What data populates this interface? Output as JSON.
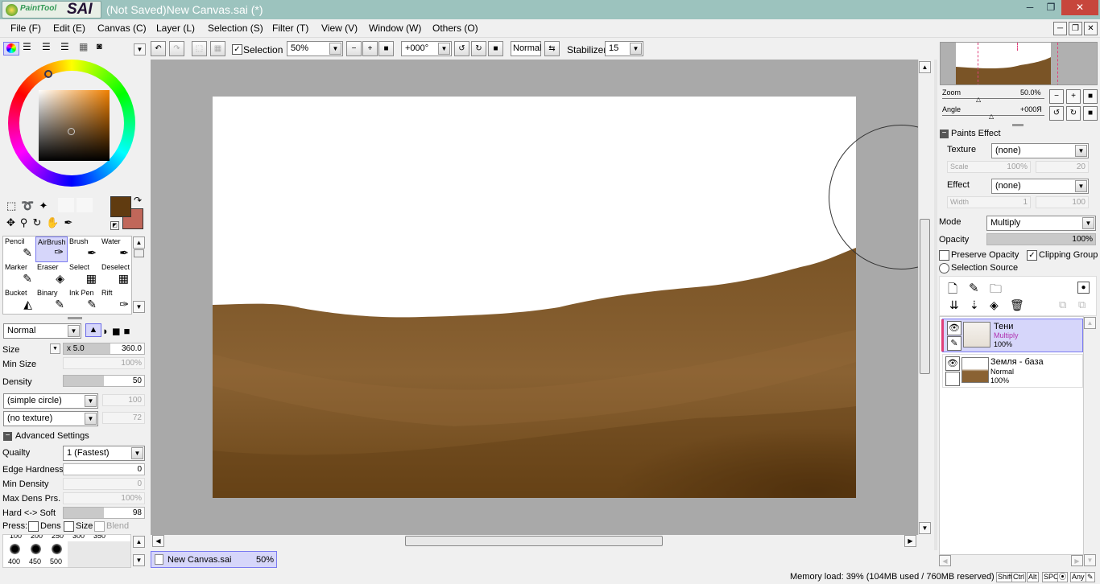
{
  "app": {
    "logo_small": "PaintTool",
    "logo_big": "SAI",
    "window_title": "(Not Saved)New Canvas.sai (*)"
  },
  "window_buttons": {
    "minimize": "─",
    "restore": "❐",
    "close": "✕"
  },
  "menu": [
    "File (F)",
    "Edit (E)",
    "Canvas (C)",
    "Layer (L)",
    "Selection (S)",
    "Filter (T)",
    "View (V)",
    "Window (W)",
    "Others (O)"
  ],
  "toolbar": {
    "selection_label": "Selection",
    "zoom_value": "50%",
    "rotation_value": "+000°",
    "blend_value": "Normal",
    "stabilizer_label": "Stabilizer",
    "stabilizer_value": "15"
  },
  "colors": {
    "primary": "#603b10",
    "secondary": "#c0675a",
    "accent_selected": "#d6d6fa",
    "title_bar": "#9cc3be",
    "clip_marker": "#e0407a"
  },
  "tools": [
    {
      "label": "Pencil",
      "icon": "✎"
    },
    {
      "label": "AirBrush",
      "icon": "✑"
    },
    {
      "label": "Brush",
      "icon": "✒"
    },
    {
      "label": "Water",
      "icon": "✒"
    },
    {
      "label": "Marker",
      "icon": "✎"
    },
    {
      "label": "Eraser",
      "icon": "◈"
    },
    {
      "label": "Select",
      "icon": "▦"
    },
    {
      "label": "Deselect",
      "icon": "▦"
    },
    {
      "label": "Bucket",
      "icon": "◭"
    },
    {
      "label": "Binary",
      "icon": "✎"
    },
    {
      "label": "Ink Pen",
      "icon": "✎"
    },
    {
      "label": "Rift",
      "icon": "✑"
    }
  ],
  "brush": {
    "blend_mode": "Normal",
    "size_label": "Size",
    "size_multiplier": "x 5.0",
    "size_value": "360.0",
    "min_size_label": "Min Size",
    "min_size_value": "100%",
    "density_label": "Density",
    "density_value": "50",
    "shape_value": "(simple circle)",
    "shape_strength": "100",
    "texture_value": "(no texture)",
    "texture_strength": "72",
    "advanced_label": "Advanced Settings",
    "quality_label": "Quailty",
    "quality_value": "1 (Fastest)",
    "edge_hardness_label": "Edge Hardness",
    "edge_hardness_value": "0",
    "min_density_label": "Min Density",
    "min_density_value": "0",
    "max_dens_label": "Max Dens Prs.",
    "max_dens_value": "100%",
    "hard_soft_label": "Hard <-> Soft",
    "hard_soft_value": "98",
    "press_label": "Press:",
    "press_dens": "Dens",
    "press_size": "Size",
    "press_blend": "Blend"
  },
  "brush_sizes_top": [
    "100",
    "200",
    "250",
    "300",
    "350"
  ],
  "brush_sizes": [
    "400",
    "450",
    "500"
  ],
  "tab": {
    "name": "New Canvas.sai",
    "zoom": "50%"
  },
  "status": {
    "memory": "Memory load: 39% (104MB used / 760MB reserved)",
    "keys": [
      "Shift",
      "Ctrl",
      "Alt",
      "SPC",
      "⦿",
      "Any",
      "✎"
    ]
  },
  "navigator": {
    "zoom_label": "Zoom",
    "zoom_value": "50.0%",
    "angle_label": "Angle",
    "angle_value": "+000Я"
  },
  "paints_effect": {
    "title": "Paints Effect",
    "texture_label": "Texture",
    "texture_value": "(none)",
    "scale_label": "Scale",
    "scale_value": "100%",
    "scale_strength": "20",
    "effect_label": "Effect",
    "effect_value": "(none)",
    "width_label": "Width",
    "width_value": "1",
    "width_strength": "100"
  },
  "layer_props": {
    "mode_label": "Mode",
    "mode_value": "Multiply",
    "opacity_label": "Opacity",
    "opacity_value": "100%",
    "opacity_fraction": 1.0,
    "preserve_opacity": "Preserve Opacity",
    "clipping_group": "Clipping Group",
    "selection_source": "Selection Source"
  },
  "layers": [
    {
      "name": "Тени",
      "mode": "Multiply",
      "opacity": "100%",
      "selected": true
    },
    {
      "name": "Земля - база",
      "mode": "Normal",
      "opacity": "100%",
      "selected": false
    }
  ]
}
